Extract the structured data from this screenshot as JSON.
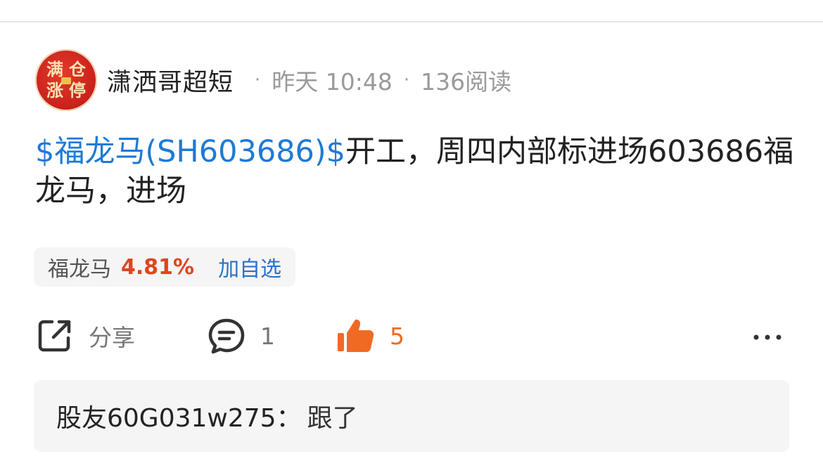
{
  "post": {
    "author": "潇洒哥超短",
    "avatar_chars": [
      "满",
      "仓",
      "涨",
      "停"
    ],
    "time": "昨天 10:48",
    "separator": "·",
    "reads": "136阅读",
    "stock_link_text": "$福龙马(SH603686)$",
    "body_text": "开工，周四内部标进场603686福龙马，进场"
  },
  "stock_chip": {
    "name": "福龙马",
    "change": "4.81%",
    "add_label": "加自选"
  },
  "actions": {
    "share_label": "分享",
    "comment_count": "1",
    "like_count": "5"
  },
  "comment": {
    "user": "股友60G031w275：",
    "text": "跟了"
  },
  "colors": {
    "link": "#1d7ad6",
    "up": "#e0451f",
    "like": "#f06a24",
    "add": "#2c72c7"
  },
  "icons": [
    "share-icon",
    "comment-icon",
    "thumbs-up-icon",
    "more-icon"
  ]
}
